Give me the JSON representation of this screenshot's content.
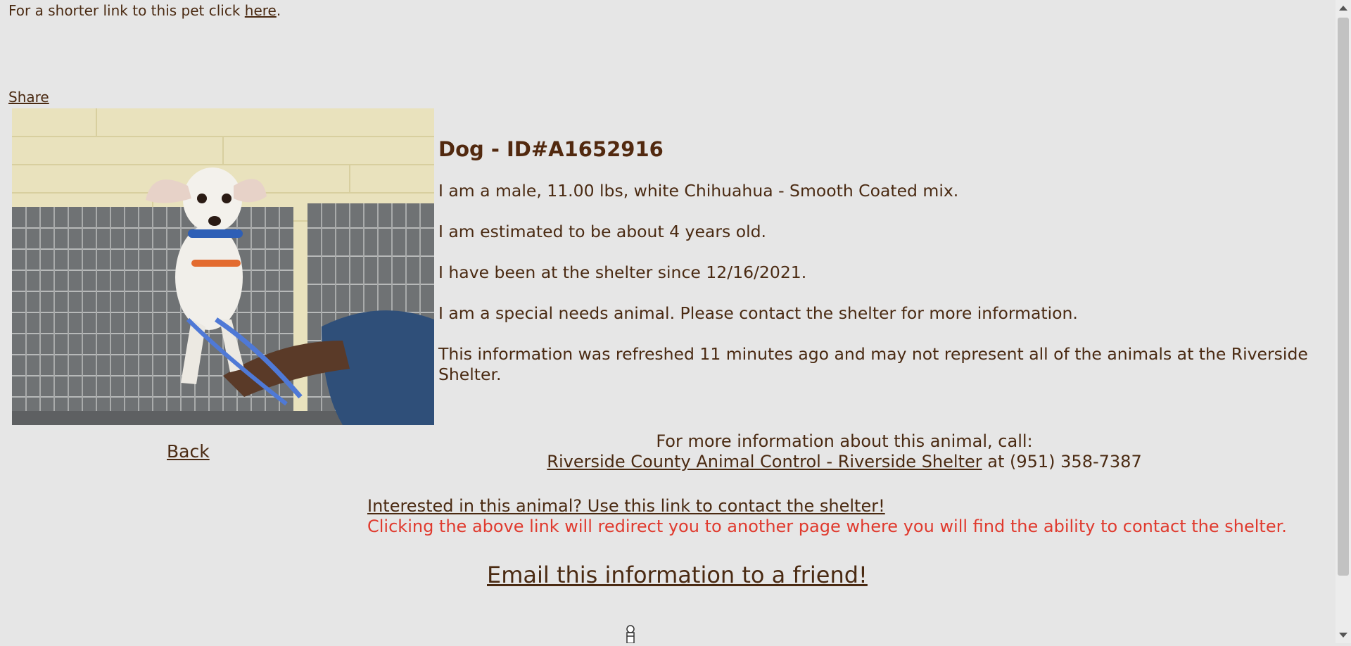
{
  "top": {
    "prefix": "For a shorter link to this pet click ",
    "link": "here",
    "suffix": "."
  },
  "share_label": "Share",
  "pet": {
    "title": "Dog - ID#A1652916",
    "description": "I am a male, 11.00 lbs, white Chihuahua - Smooth Coated mix.",
    "age": "I am estimated to be about 4 years old.",
    "since": "I have been at the shelter since 12/16/2021.",
    "special_needs": "I am a special needs animal. Please contact the shelter for more information.",
    "refresh_note": "This information was refreshed 11 minutes ago and may not represent all of the animals at the Riverside Shelter."
  },
  "back_label": "Back",
  "contact": {
    "call_text": "For more information about this animal, call:",
    "shelter_link": "Riverside County Animal Control - Riverside Shelter",
    "phone_text": " at (951) 358-7387"
  },
  "interest": {
    "link": "Interested in this animal? Use this link to contact the shelter!",
    "note": "Clicking the above link will redirect you to another page where you will find the ability to contact the shelter."
  },
  "email_label": "Email this information to a friend!",
  "colors": {
    "background": "#e6e6e6",
    "text": "#4a2a12",
    "warning": "#e03a2e"
  },
  "icons": {
    "photo": "dog-photo",
    "bottom": "pin-icon"
  }
}
